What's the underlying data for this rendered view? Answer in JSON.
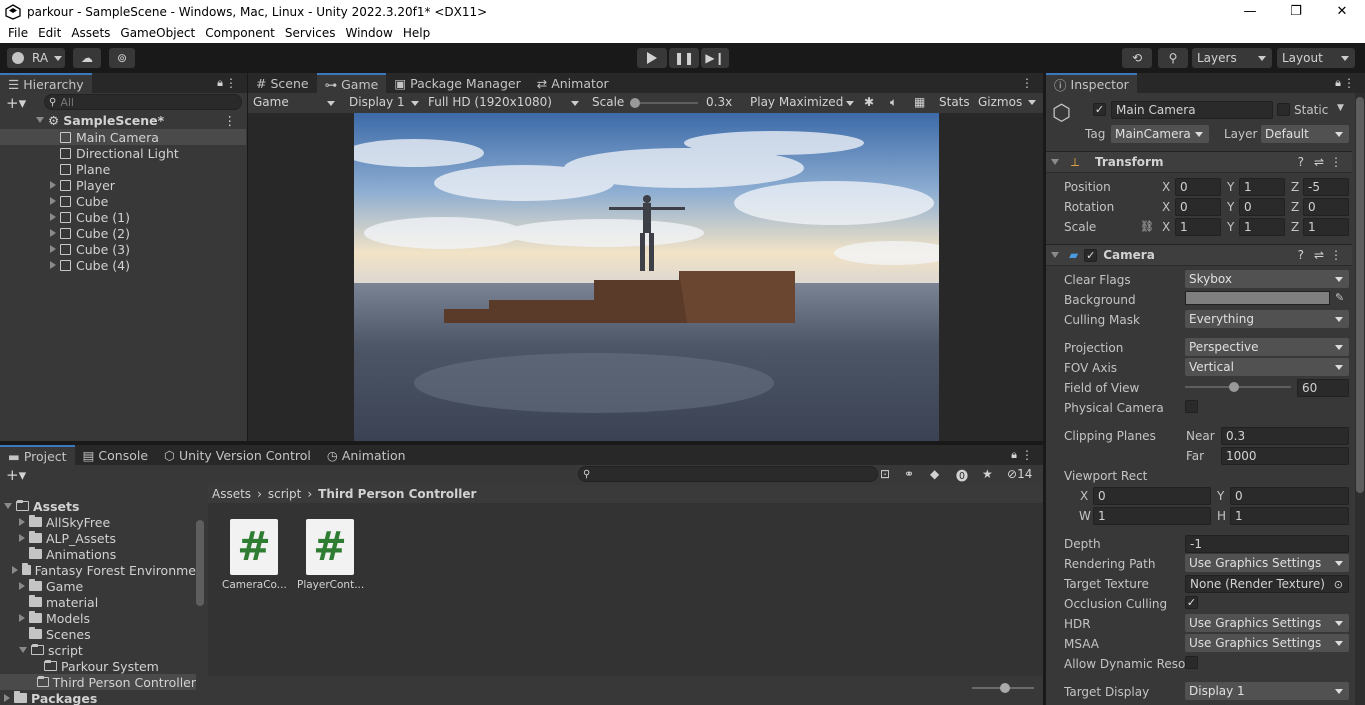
{
  "window": {
    "title": "parkour - SampleScene - Windows, Mac, Linux - Unity 2022.3.20f1* <DX11>"
  },
  "menu": [
    "File",
    "Edit",
    "Assets",
    "GameObject",
    "Component",
    "Services",
    "Window",
    "Help"
  ],
  "toolbar": {
    "account": "RA",
    "layers": "Layers",
    "layout": "Layout"
  },
  "hierarchy": {
    "tab": "Hierarchy",
    "search_placeholder": "All",
    "scene": "SampleScene*",
    "items": [
      {
        "label": "Main Camera",
        "expandable": false,
        "selected": true
      },
      {
        "label": "Directional Light",
        "expandable": false
      },
      {
        "label": "Plane",
        "expandable": false
      },
      {
        "label": "Player",
        "expandable": true
      },
      {
        "label": "Cube",
        "expandable": true
      },
      {
        "label": "Cube (1)",
        "expandable": true
      },
      {
        "label": "Cube (2)",
        "expandable": true
      },
      {
        "label": "Cube (3)",
        "expandable": true
      },
      {
        "label": "Cube (4)",
        "expandable": true
      }
    ]
  },
  "center_tabs": [
    "Scene",
    "Game",
    "Package Manager",
    "Animator"
  ],
  "game_bar": {
    "mode": "Game",
    "display": "Display 1",
    "resolution": "Full HD (1920x1080)",
    "scale_label": "Scale",
    "scale_value": "0.3x",
    "play": "Play Maximized",
    "stats": "Stats",
    "gizmos": "Gizmos"
  },
  "bottom_tabs": [
    "Project",
    "Console",
    "Unity Version Control",
    "Animation"
  ],
  "project": {
    "hidden_count": "14",
    "tree": [
      {
        "label": "Assets",
        "level": 0,
        "open": true
      },
      {
        "label": "AllSkyFree",
        "level": 1
      },
      {
        "label": "ALP_Assets",
        "level": 1
      },
      {
        "label": "Animations",
        "level": 1,
        "noarrow": true
      },
      {
        "label": "Fantasy Forest Environme",
        "level": 1
      },
      {
        "label": "Game",
        "level": 1
      },
      {
        "label": "material",
        "level": 1,
        "noarrow": true
      },
      {
        "label": "Models",
        "level": 1
      },
      {
        "label": "Scenes",
        "level": 1,
        "noarrow": true
      },
      {
        "label": "script",
        "level": 1,
        "open": true
      },
      {
        "label": "Parkour System",
        "level": 2
      },
      {
        "label": "Third Person Controller",
        "level": 2,
        "selected": true
      },
      {
        "label": "Packages",
        "level": 0
      }
    ],
    "breadcrumb": [
      "Assets",
      "script",
      "Third Person Controller"
    ],
    "files": [
      {
        "label": "CameraCo..."
      },
      {
        "label": "PlayerCont..."
      }
    ]
  },
  "inspector": {
    "tab": "Inspector",
    "object_name": "Main Camera",
    "static_label": "Static",
    "tag_label": "Tag",
    "tag_value": "MainCamera",
    "layer_label": "Layer",
    "layer_value": "Default",
    "transform": {
      "title": "Transform",
      "position": {
        "label": "Position",
        "x": "0",
        "y": "1",
        "z": "-5"
      },
      "rotation": {
        "label": "Rotation",
        "x": "0",
        "y": "0",
        "z": "0"
      },
      "scale": {
        "label": "Scale",
        "x": "1",
        "y": "1",
        "z": "1"
      }
    },
    "camera": {
      "title": "Camera",
      "clear_flags": {
        "label": "Clear Flags",
        "value": "Skybox"
      },
      "background": {
        "label": "Background"
      },
      "culling_mask": {
        "label": "Culling Mask",
        "value": "Everything"
      },
      "projection": {
        "label": "Projection",
        "value": "Perspective"
      },
      "fov_axis": {
        "label": "FOV Axis",
        "value": "Vertical"
      },
      "field_of_view": {
        "label": "Field of View",
        "value": "60",
        "fraction": 0.2
      },
      "physical_camera": {
        "label": "Physical Camera"
      },
      "clipping": {
        "label": "Clipping Planes",
        "near_label": "Near",
        "near": "0.3",
        "far_label": "Far",
        "far": "1000"
      },
      "viewport": {
        "label": "Viewport Rect",
        "x": "0",
        "y": "0",
        "w": "1",
        "h": "1"
      },
      "depth": {
        "label": "Depth",
        "value": "-1"
      },
      "rendering_path": {
        "label": "Rendering Path",
        "value": "Use Graphics Settings"
      },
      "target_texture": {
        "label": "Target Texture",
        "value": "None (Render Texture)"
      },
      "occlusion": {
        "label": "Occlusion Culling"
      },
      "hdr": {
        "label": "HDR",
        "value": "Use Graphics Settings"
      },
      "msaa": {
        "label": "MSAA",
        "value": "Use Graphics Settings"
      },
      "dynamic_res": {
        "label": "Allow Dynamic Resol"
      },
      "target_display": {
        "label": "Target Display",
        "value": "Display 1"
      }
    }
  }
}
